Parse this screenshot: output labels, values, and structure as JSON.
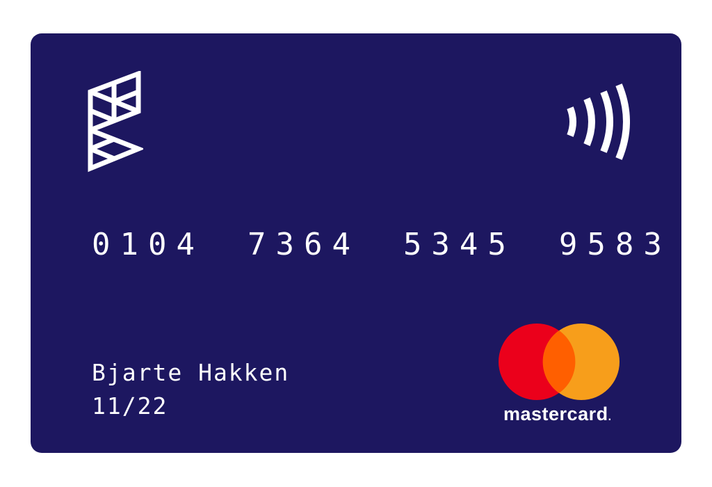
{
  "card": {
    "number_groups": [
      "0104",
      "7364",
      "5345",
      "9583"
    ],
    "holder_name": "Bjarte Hakken",
    "expiry": "11/22",
    "brand_wordmark": "mastercard",
    "brand_mark": ".",
    "colors": {
      "card_background": "#1d1760",
      "text": "#ffffff",
      "mastercard_red": "#eb001b",
      "mastercard_orange": "#f79e1b",
      "mastercard_overlap": "#ff5f00"
    },
    "icons": [
      "issuer-logo-icon",
      "contactless-icon",
      "mastercard-circles-icon"
    ]
  }
}
